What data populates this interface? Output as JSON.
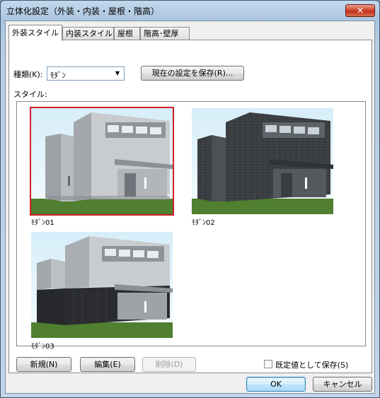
{
  "window": {
    "title": "立体化設定（外装・内装・屋根・階高）",
    "close_label": "✕"
  },
  "tabs": [
    {
      "label": "外装スタイル",
      "active": true
    },
    {
      "label": "内装スタイル",
      "active": false
    },
    {
      "label": "屋根",
      "active": false
    },
    {
      "label": "階高･壁厚",
      "active": false
    }
  ],
  "type_row": {
    "label": "種類(K):",
    "selected": "ﾓﾀﾞﾝ",
    "save_current_label": "現在の設定を保存(R)..."
  },
  "style_section": {
    "label": "スタイル:",
    "items": [
      {
        "caption": "ﾓﾀﾞﾝ01",
        "selected": true,
        "variant": "light"
      },
      {
        "caption": "ﾓﾀﾞﾝ02",
        "selected": false,
        "variant": "dark"
      },
      {
        "caption": "ﾓﾀﾞﾝ03",
        "selected": false,
        "variant": "two-tone"
      }
    ]
  },
  "actions": {
    "new_label": "新規(N)",
    "edit_label": "編集(E)",
    "delete_label": "削除(D)",
    "delete_disabled": true
  },
  "default_save": {
    "label": "既定値として保存(S)",
    "checked": false
  },
  "footer": {
    "ok_label": "OK",
    "cancel_label": "キャンセル"
  },
  "colors": {
    "selection_outline": "#d21f26",
    "sky_top": "#d6eef9",
    "sky_bottom": "#f4fbff",
    "grass": "#4f7f2f"
  }
}
